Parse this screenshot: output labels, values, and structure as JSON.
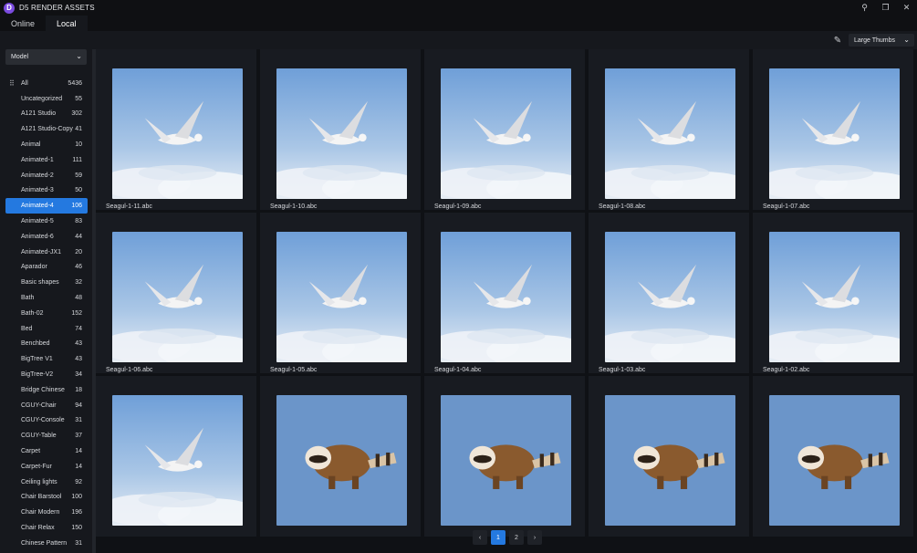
{
  "app": {
    "title": "D5 RENDER ASSETS",
    "logo": "D"
  },
  "window_controls": {
    "pin": "⚲",
    "restore": "❐",
    "close": "✕"
  },
  "tabs": [
    {
      "label": "Online"
    },
    {
      "label": "Local"
    }
  ],
  "toolbar": {
    "view_mode": "Large Thumbs",
    "edit_icon": "✎",
    "chevron": "⌄"
  },
  "sidebar": {
    "filter": "Model",
    "categories": [
      {
        "name": "All",
        "count": "5436"
      },
      {
        "name": "Uncategorized",
        "count": "55"
      },
      {
        "name": "A121 Studio",
        "count": "302"
      },
      {
        "name": "A121 Studio-Copy",
        "count": "41"
      },
      {
        "name": "Animal",
        "count": "10"
      },
      {
        "name": "Animated-1",
        "count": "111"
      },
      {
        "name": "Animated-2",
        "count": "59"
      },
      {
        "name": "Animated-3",
        "count": "50"
      },
      {
        "name": "Animated-4",
        "count": "106"
      },
      {
        "name": "Animated-5",
        "count": "83"
      },
      {
        "name": "Animated-6",
        "count": "44"
      },
      {
        "name": "Animated-JX1",
        "count": "20"
      },
      {
        "name": "Aparador",
        "count": "46"
      },
      {
        "name": "Basic shapes",
        "count": "32"
      },
      {
        "name": "Bath",
        "count": "48"
      },
      {
        "name": "Bath-02",
        "count": "152"
      },
      {
        "name": "Bed",
        "count": "74"
      },
      {
        "name": "Benchbed",
        "count": "43"
      },
      {
        "name": "BigTree V1",
        "count": "43"
      },
      {
        "name": "BigTree-V2",
        "count": "34"
      },
      {
        "name": "Bridge Chinese",
        "count": "18"
      },
      {
        "name": "CGUY-Chair",
        "count": "94"
      },
      {
        "name": "CGUY-Console",
        "count": "31"
      },
      {
        "name": "CGUY-Table",
        "count": "37"
      },
      {
        "name": "Carpet",
        "count": "14"
      },
      {
        "name": "Carpet-Fur",
        "count": "14"
      },
      {
        "name": "Ceiling lights",
        "count": "92"
      },
      {
        "name": "Chair Barstool",
        "count": "100"
      },
      {
        "name": "Chair Modern",
        "count": "196"
      },
      {
        "name": "Chair Relax",
        "count": "150"
      },
      {
        "name": "Chinese Pattern",
        "count": "31"
      }
    ]
  },
  "assets": [
    {
      "name": "Seagul-1-11.abc",
      "kind": "seagull"
    },
    {
      "name": "Seagul-1-10.abc",
      "kind": "seagull"
    },
    {
      "name": "Seagul-1-09.abc",
      "kind": "seagull"
    },
    {
      "name": "Seagul-1-08.abc",
      "kind": "seagull"
    },
    {
      "name": "Seagul-1-07.abc",
      "kind": "seagull"
    },
    {
      "name": "Seagul-1-06.abc",
      "kind": "seagull"
    },
    {
      "name": "Seagul-1-05.abc",
      "kind": "seagull"
    },
    {
      "name": "Seagul-1-04.abc",
      "kind": "seagull"
    },
    {
      "name": "Seagul-1-03.abc",
      "kind": "seagull"
    },
    {
      "name": "Seagul-1-02.abc",
      "kind": "seagull"
    },
    {
      "name": "",
      "kind": "seagull"
    },
    {
      "name": "",
      "kind": "raccoon"
    },
    {
      "name": "",
      "kind": "raccoon"
    },
    {
      "name": "",
      "kind": "raccoon"
    },
    {
      "name": "",
      "kind": "raccoon"
    }
  ],
  "pagination": {
    "prev": "‹",
    "pages": [
      "1",
      "2"
    ],
    "next": "›",
    "current": "1"
  },
  "colors": {
    "accent": "#2479e0",
    "sky": "#6f9fd8",
    "cloud": "#e8eef5",
    "raccoon_bg": "#6b95c9"
  }
}
